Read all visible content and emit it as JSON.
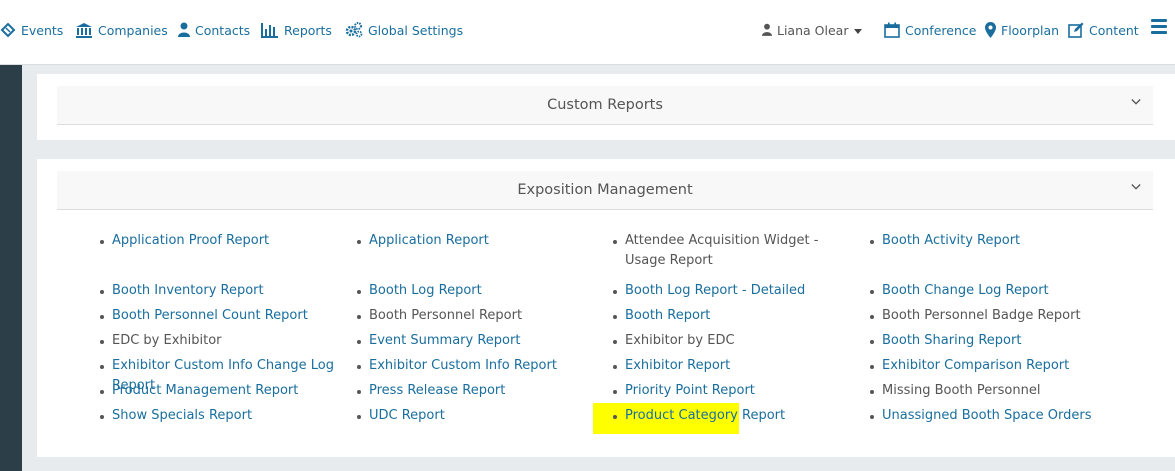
{
  "nav": {
    "events": "Events",
    "companies": "Companies",
    "contacts": "Contacts",
    "reports": "Reports",
    "global_settings": "Global Settings",
    "user": "Liana Olear",
    "conference": "Conference",
    "floorplan": "Floorplan",
    "content": "Content"
  },
  "colors": {
    "link": "#1a6e9e",
    "highlight": "#ffff00",
    "sidebar": "#2c3e48"
  },
  "custom_reports": {
    "title": "Custom Reports"
  },
  "exposition": {
    "title": "Exposition Management",
    "items": [
      {
        "label": "Application Proof Report",
        "link": true
      },
      {
        "label": "Application Report",
        "link": true
      },
      {
        "label": "Attendee Acquisition Widget - Usage Report",
        "link": false
      },
      {
        "label": "Booth Activity Report",
        "link": true
      },
      {
        "label": "Booth Inventory Report",
        "link": true
      },
      {
        "label": "Booth Log Report",
        "link": true
      },
      {
        "label": "Booth Log Report - Detailed",
        "link": true
      },
      {
        "label": "Booth Change Log Report",
        "link": true
      },
      {
        "label": "Booth Personnel Count Report",
        "link": true
      },
      {
        "label": "Booth Personnel Report",
        "link": false
      },
      {
        "label": "Booth Report",
        "link": true
      },
      {
        "label": "Booth Personnel Badge Report",
        "link": false
      },
      {
        "label": "EDC by Exhibitor",
        "link": false
      },
      {
        "label": "Event Summary Report",
        "link": true
      },
      {
        "label": "Exhibitor by EDC",
        "link": false
      },
      {
        "label": "Booth Sharing Report",
        "link": true
      },
      {
        "label": "Exhibitor Custom Info Change Log Report",
        "link": true
      },
      {
        "label": "Exhibitor Custom Info Report",
        "link": true
      },
      {
        "label": "Exhibitor Report",
        "link": true
      },
      {
        "label": "Exhibitor Comparison Report",
        "link": true
      },
      {
        "label": "Product Management Report",
        "link": true
      },
      {
        "label": "Press Release Report",
        "link": true
      },
      {
        "label": "Priority Point Report",
        "link": true
      },
      {
        "label": "Missing Booth Personnel",
        "link": false
      },
      {
        "label": "Show Specials Report",
        "link": true
      },
      {
        "label": "UDC Report",
        "link": true,
        "highlighted": true
      },
      {
        "label": "Product Category Report",
        "link": true
      },
      {
        "label": "Unassigned Booth Space Orders",
        "link": true
      }
    ]
  }
}
